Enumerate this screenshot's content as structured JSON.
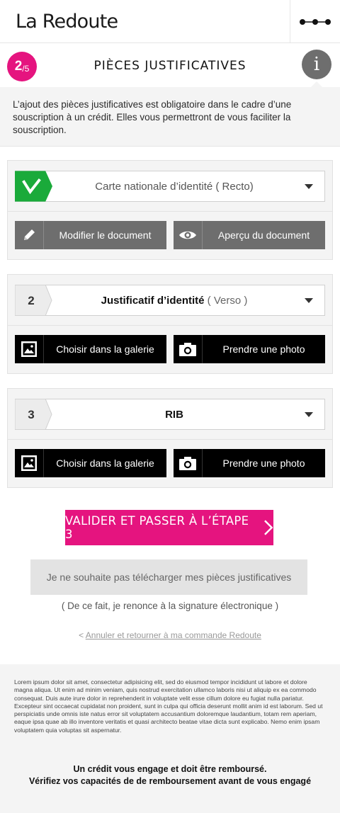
{
  "header": {
    "logo": "La Redoute",
    "menu_icon": "more-dots-icon"
  },
  "step": {
    "current": "2",
    "total": "/5",
    "title": "PIÈCES JUSTIFICATIVES",
    "info_label": "i"
  },
  "intro": {
    "text": "L’ajout des pièces justificatives est obligatoire dans le cadre d’une souscription à un crédit. Elles vous permettront de vous faciliter la souscription."
  },
  "documents": [
    {
      "status": "done",
      "number": "",
      "title": "Carte nationale d’identité",
      "subtitle": "( Recto)",
      "actions": [
        {
          "label": "Modifier le document",
          "icon": "pencil-icon"
        },
        {
          "label": "Aperçu du document",
          "icon": "eye-icon"
        }
      ]
    },
    {
      "status": "pending",
      "number": "2",
      "title": "Justificatif d’identité",
      "subtitle": "( Verso )",
      "actions": [
        {
          "label": "Choisir dans la galerie",
          "icon": "gallery-icon"
        },
        {
          "label": "Prendre une photo",
          "icon": "camera-icon"
        }
      ]
    },
    {
      "status": "pending",
      "number": "3",
      "title": "RIB",
      "subtitle": "",
      "actions": [
        {
          "label": "Choisir dans la galerie",
          "icon": "gallery-icon"
        },
        {
          "label": "Prendre une photo",
          "icon": "camera-icon"
        }
      ]
    }
  ],
  "actions": {
    "validate_label": "VALIDER ET PASSER À L’ÉTAPE 3",
    "skip_label": "Je ne souhaite pas télécharger mes pièces justificatives",
    "skip_note": "( De ce fait, je renonce à la signature électronique )",
    "cancel_prefix": "<",
    "cancel_label": "Annuler et retourner à ma commande Redoute"
  },
  "footer": {
    "lorem": "Lorem ipsum dolor sit amet, consectetur adipisicing elit, sed do eiusmod tempor incididunt ut labore et dolore magna aliqua. Ut enim ad minim veniam, quis nostrud exercitation ullamco laboris nisi ut aliquip ex ea commodo consequat. Duis aute irure dolor in reprehenderit in voluptate velit esse cillum dolore eu fugiat nulla pariatur. Excepteur sint occaecat cupidatat non proident, sunt in culpa qui officia deserunt mollit anim id est laborum. Sed ut perspiciatis unde omnis iste natus error sit voluptatem accusantium doloremque laudantium, totam rem aperiam, eaque ipsa quae ab illo inventore veritatis et quasi architecto beatae vitae dicta sunt explicabo. Nemo enim ipsam voluptatem quia voluptas sit aspernatur.",
    "warning_line1": "Un crédit vous engage et doit être remboursé.",
    "warning_line2": "Vérifiez vos capacités de de remboursement avant de vous engagé"
  },
  "colors": {
    "accent": "#e5147f",
    "success": "#1aaa3a",
    "grey_button": "#6e6e6e",
    "black_button": "#000000"
  }
}
